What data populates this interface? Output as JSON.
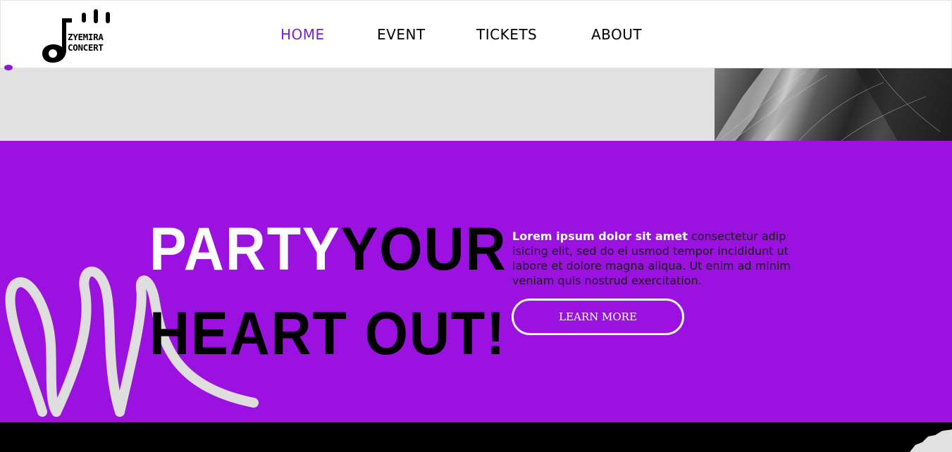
{
  "header": {
    "logo": {
      "line1": "ZYEMIRA",
      "line2": "CONCERT",
      "icon": "music-note-icon"
    },
    "nav": [
      {
        "label": "HOME",
        "active": true
      },
      {
        "label": "EVENT",
        "active": false
      },
      {
        "label": "TICKETS",
        "active": false
      },
      {
        "label": "ABOUT",
        "active": false
      }
    ]
  },
  "hero": {
    "headline_word1": "PARTY",
    "headline_word2": "YOUR",
    "headline_line2": "HEART OUT!",
    "lead_text": "Lorem ipsum dolor sit amet",
    "body_text": " consectetur adip isicing elit, sed do ei usmod tempor incididunt ut labore et dolore magna aliqua. Ut enim ad minim veniam quis nostrud exercitation.",
    "button_label": "LEARN MORE"
  },
  "colors": {
    "accent": "#9b12e0",
    "nav_active": "#7a1fd6",
    "grey": "#e1e1e1"
  }
}
